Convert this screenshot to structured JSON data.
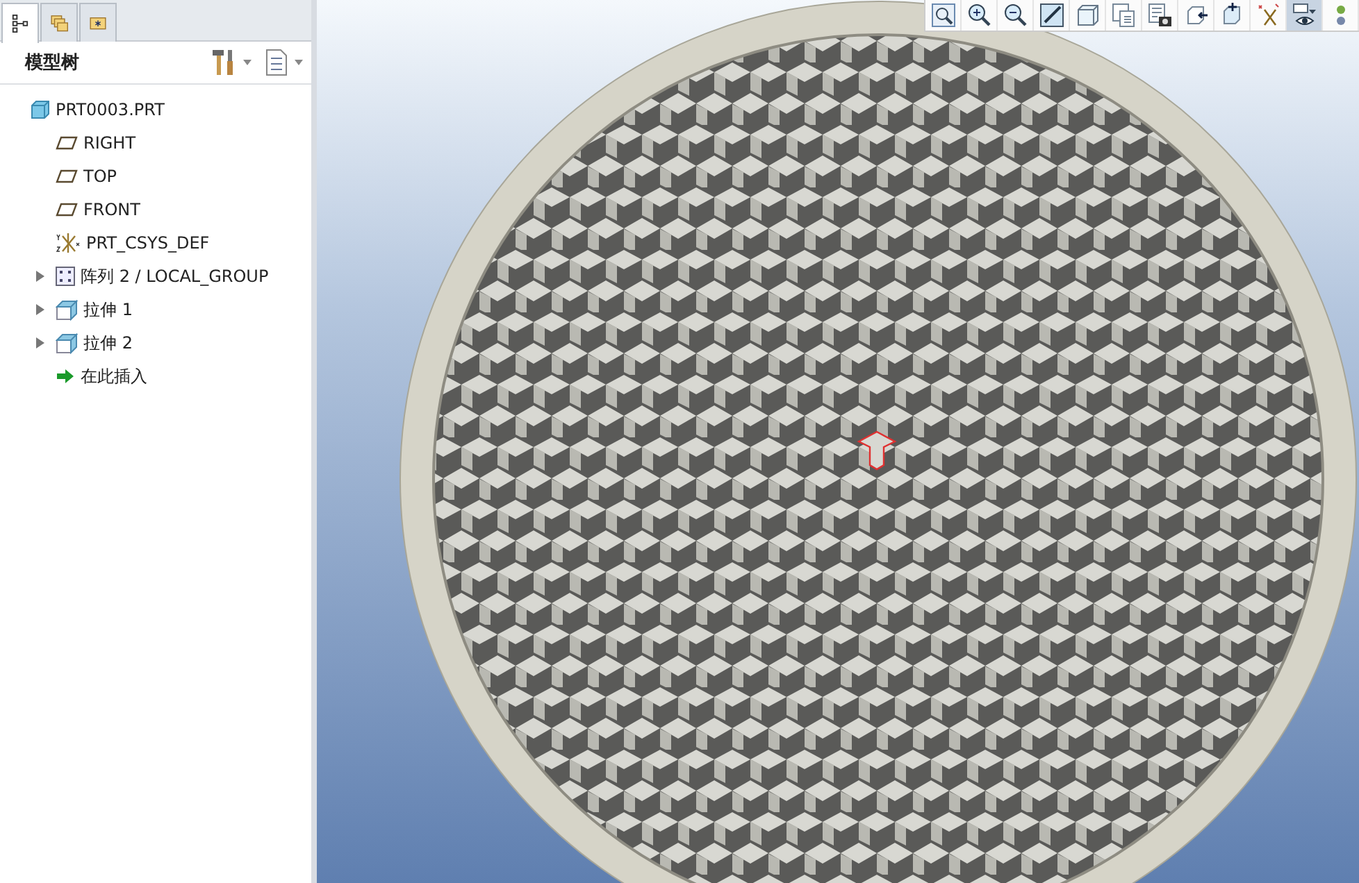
{
  "panel_tabs": [
    {
      "kind": "tree",
      "selected": true
    },
    {
      "kind": "folders",
      "selected": false
    },
    {
      "kind": "favorites",
      "selected": false
    }
  ],
  "panel_header": {
    "title": "模型树",
    "tools": [
      {
        "kind": "settings"
      },
      {
        "kind": "show"
      }
    ]
  },
  "model_tree": [
    {
      "kind": "part",
      "label": "PRT0003.PRT",
      "expandable": false,
      "children": [
        {
          "kind": "plane",
          "label": "RIGHT",
          "expandable": false
        },
        {
          "kind": "plane",
          "label": "TOP",
          "expandable": false
        },
        {
          "kind": "plane",
          "label": "FRONT",
          "expandable": false
        },
        {
          "kind": "csys",
          "label": "PRT_CSYS_DEF",
          "expandable": false
        },
        {
          "kind": "pattern",
          "label": "阵列 2 / LOCAL_GROUP",
          "expandable": true
        },
        {
          "kind": "extrude",
          "label": "拉伸 1",
          "expandable": true
        },
        {
          "kind": "extrude",
          "label": "拉伸 2",
          "expandable": true
        },
        {
          "kind": "insert",
          "label": "在此插入",
          "expandable": false
        }
      ]
    }
  ],
  "view_toolbar": [
    {
      "kind": "refit",
      "selected": false
    },
    {
      "kind": "zoom-in",
      "selected": false
    },
    {
      "kind": "zoom-out",
      "selected": false
    },
    {
      "kind": "repaint",
      "selected": false
    },
    {
      "kind": "display-style",
      "selected": false
    },
    {
      "kind": "saved-views",
      "selected": false
    },
    {
      "kind": "view-manager",
      "selected": false
    },
    {
      "kind": "orient",
      "selected": false
    },
    {
      "kind": "spin-center",
      "selected": false
    },
    {
      "kind": "datum-display",
      "selected": false
    },
    {
      "kind": "annotation-display",
      "selected": true
    },
    {
      "kind": "appearance",
      "selected": false
    }
  ]
}
